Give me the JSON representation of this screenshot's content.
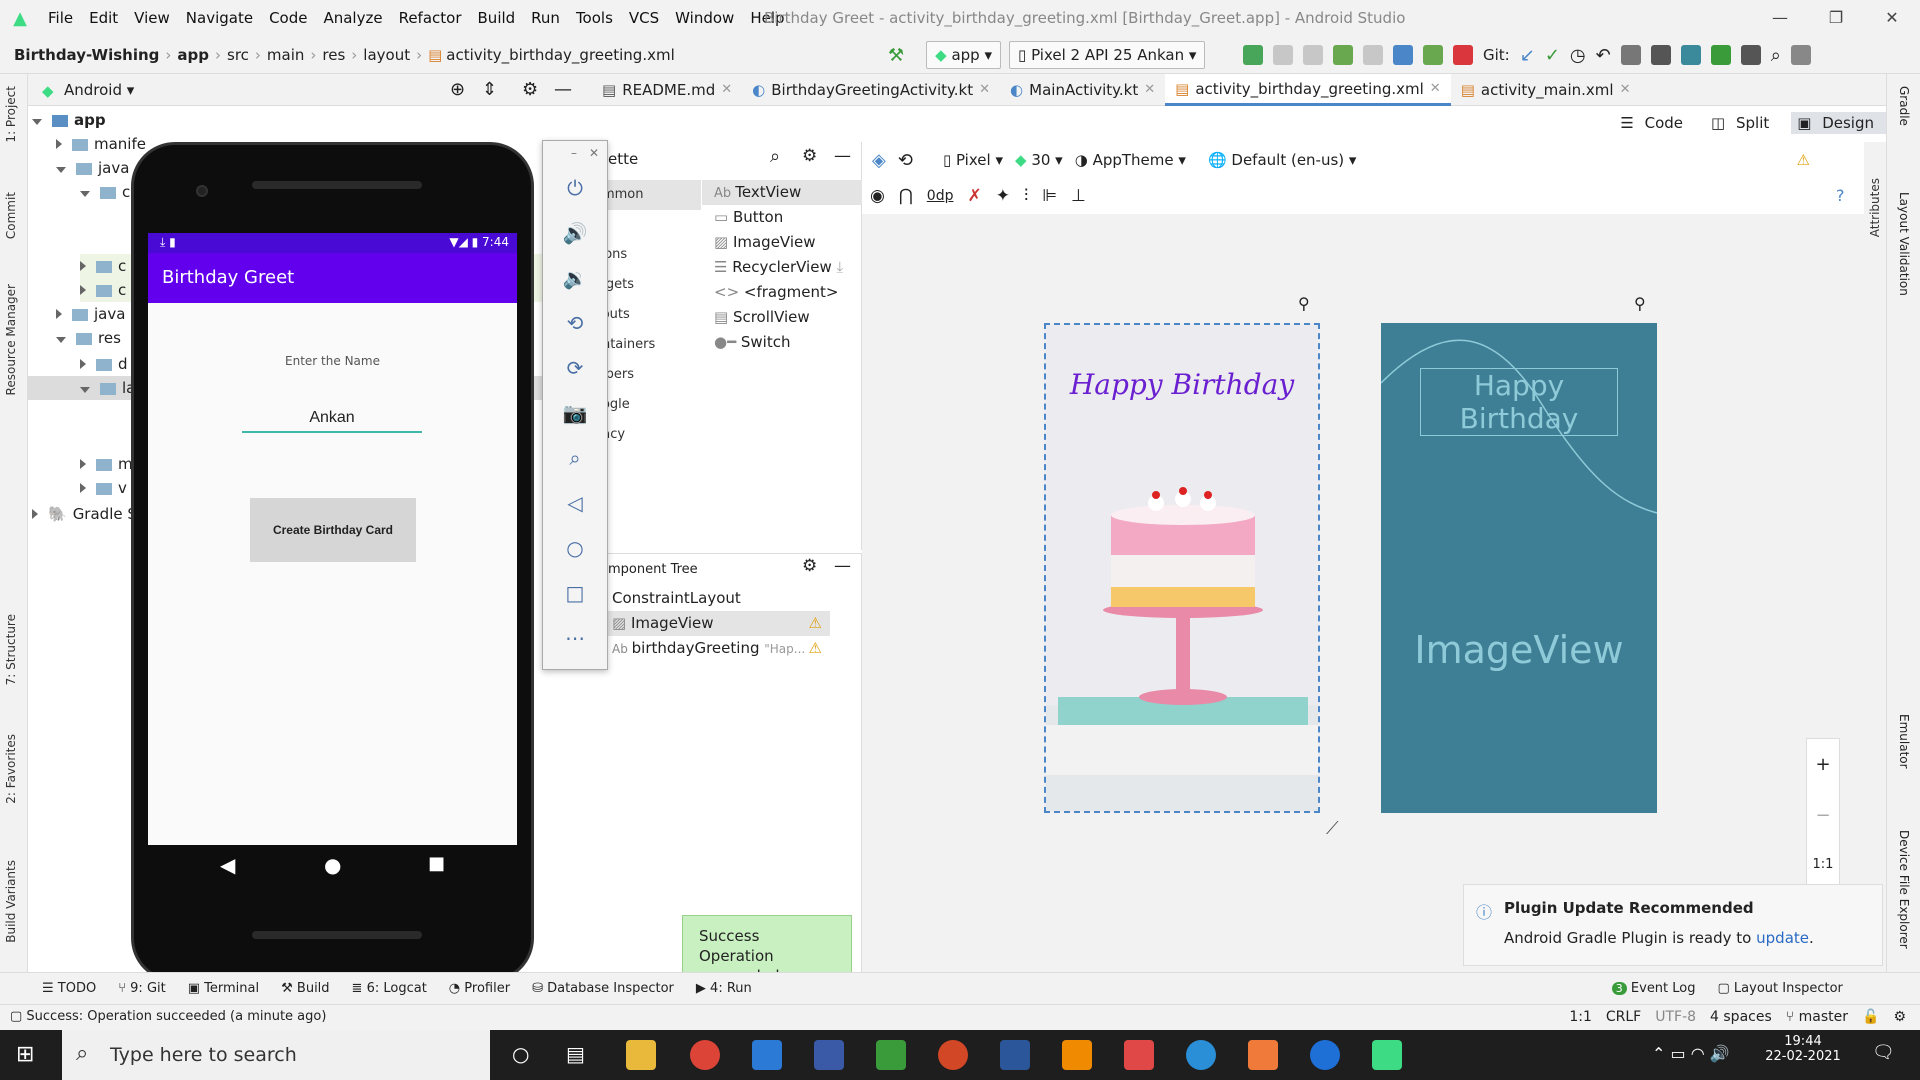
{
  "menu": {
    "items": [
      "File",
      "Edit",
      "View",
      "Navigate",
      "Code",
      "Analyze",
      "Refactor",
      "Build",
      "Run",
      "Tools",
      "VCS",
      "Window",
      "Help"
    ],
    "title": "Birthday Greet - activity_birthday_greeting.xml [Birthday_Greet.app] - Android Studio"
  },
  "breadcrumb": [
    "Birthday-Wishing",
    "app",
    "src",
    "main",
    "res",
    "layout",
    "activity_birthday_greeting.xml"
  ],
  "run_config": {
    "module": "app",
    "device": "Pixel 2 API 25 Ankan",
    "git_label": "Git:"
  },
  "project": {
    "view": "Android",
    "tree": [
      {
        "label": "app"
      },
      {
        "label": "manife"
      },
      {
        "label": "java"
      },
      {
        "label": "c"
      },
      {
        "label": "c"
      },
      {
        "label": "c"
      },
      {
        "label": "java"
      },
      {
        "label": "res"
      },
      {
        "label": "d"
      },
      {
        "label": "la"
      },
      {
        "label": "m"
      },
      {
        "label": "v"
      },
      {
        "label": "Gradle S"
      }
    ]
  },
  "left_tabs": [
    "1: Project",
    "Commit",
    "Resource Manager",
    "7: Structure",
    "2: Favorites",
    "Build Variants"
  ],
  "right_tabs": [
    "Gradle",
    "Layout Validation",
    "Emulator",
    "Device File Explorer",
    "Attributes"
  ],
  "editor_tabs": [
    {
      "label": "README.md"
    },
    {
      "label": "BirthdayGreetingActivity.kt"
    },
    {
      "label": "MainActivity.kt"
    },
    {
      "label": "activity_birthday_greeting.xml",
      "active": true
    },
    {
      "label": "activity_main.xml"
    }
  ],
  "view_modes": [
    "Code",
    "Split",
    "Design"
  ],
  "palette": {
    "title": "ette",
    "categories": [
      "ommon",
      "xt",
      "ttons",
      "idgets",
      "youts",
      "ontainers",
      "elpers",
      "oogle",
      "gacy"
    ],
    "items": [
      "TextView",
      "Button",
      "ImageView",
      "RecyclerView",
      "<fragment>",
      "ScrollView",
      "Switch"
    ]
  },
  "component_tree": {
    "title": "mponent Tree",
    "nodes": [
      {
        "label": "ConstraintLayout"
      },
      {
        "label": "ImageView"
      },
      {
        "label": "birthdayGreeting",
        "hint": "\"Hap..."
      }
    ]
  },
  "design_toolbar": {
    "device": "Pixel",
    "api": "30",
    "theme": "AppTheme",
    "locale": "Default (en-us)",
    "margin": "0dp"
  },
  "design": {
    "preview_text": "Happy Birthday",
    "blueprint_text": "Happy Birthday",
    "blueprint_image_label": "ImageView",
    "zoom_reset": "1:1"
  },
  "emulator": {
    "time": "7:44",
    "app_title": "Birthday Greet",
    "enter_label": "Enter the Name",
    "name_value": "Ankan",
    "button_label": "Create Birthday Card"
  },
  "toast": {
    "title": "Success",
    "message": "Operation succeeded"
  },
  "notification": {
    "title": "Plugin Update Recommended",
    "body": "Android Gradle Plugin is ready to",
    "link": "update",
    "end": "."
  },
  "bottom_tabs": [
    "TODO",
    "9: Git",
    "Terminal",
    "Build",
    "6: Logcat",
    "Profiler",
    "Database Inspector",
    "4: Run"
  ],
  "bottom_right": {
    "events": "Event Log",
    "events_count": "3",
    "inspector": "Layout Inspector"
  },
  "status": {
    "message": "Success: Operation succeeded (a minute ago)",
    "position": "1:1",
    "line_sep": "CRLF",
    "encoding": "UTF-8",
    "indent": "4 spaces",
    "branch": "master"
  },
  "taskbar": {
    "search_placeholder": "Type here to search",
    "time": "19:44",
    "date": "22-02-2021"
  },
  "colors": {
    "accent": "#6200ee",
    "ide_blue": "#4a86c8",
    "blueprint": "#3f7f96",
    "success": "#c9f0c0"
  }
}
